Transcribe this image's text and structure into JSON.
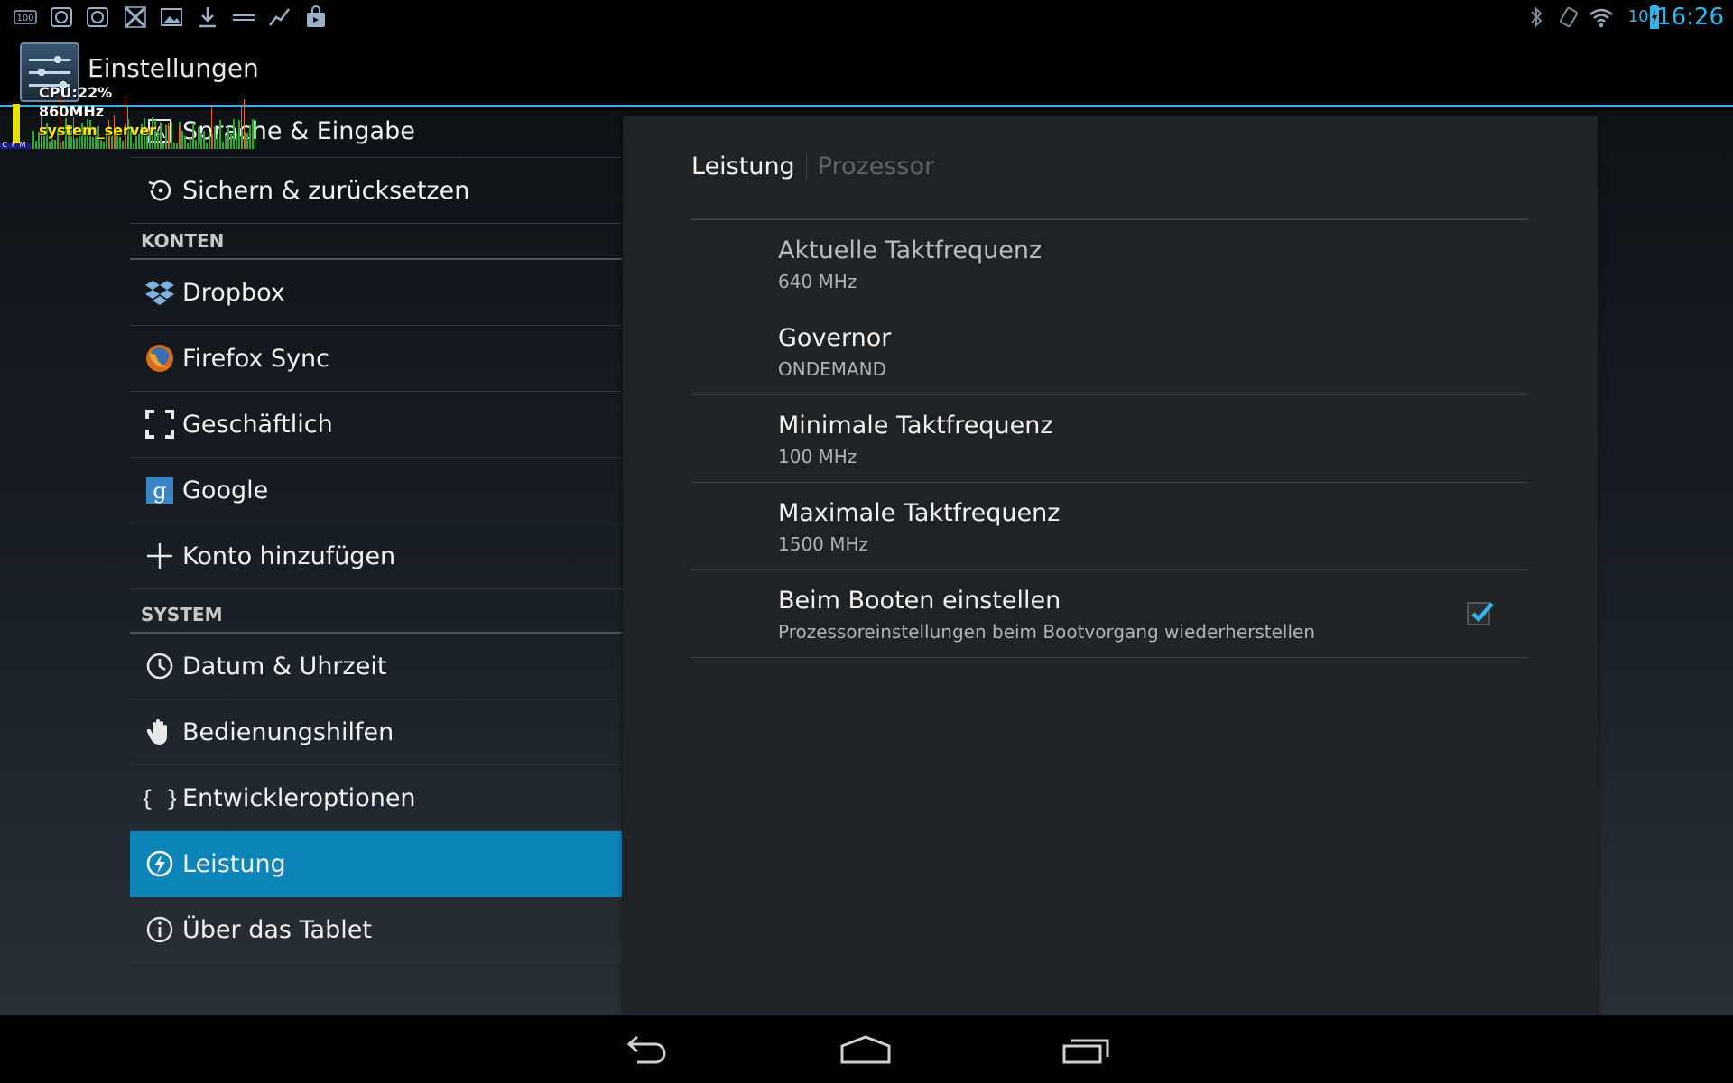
{
  "status_bar": {
    "notification_badge": "100",
    "battery_level": "100",
    "clock": "16:26",
    "left_icons": [
      "counter-badge-icon",
      "app-notification-icon",
      "app-notification-icon",
      "tools-icon",
      "image-icon",
      "download-icon",
      "keyboard-icon",
      "chart-icon",
      "shopping-bag-icon"
    ],
    "right_icons": [
      "bluetooth-icon",
      "screen-rotation-icon",
      "wifi-icon",
      "battery-charging-icon"
    ]
  },
  "action_bar": {
    "title": "Einstellungen",
    "app_icon": "settings-sliders-icon"
  },
  "cpu_overlay": {
    "cpu_label": "CPU:22%",
    "frequency_label": "860MHz",
    "process_label": "system_server",
    "legend_letters": [
      "C",
      "F",
      "M"
    ]
  },
  "settings_list": {
    "items": [
      {
        "label": "Sprache & Eingabe",
        "icon": "language-input-icon"
      },
      {
        "label": "Sichern & zurücksetzen",
        "icon": "backup-reset-icon"
      },
      {
        "label": "Dropbox",
        "icon": "dropbox-icon"
      },
      {
        "label": "Firefox Sync",
        "icon": "firefox-icon"
      },
      {
        "label": "Geschäftlich",
        "icon": "corporate-frame-icon"
      },
      {
        "label": "Google",
        "icon": "google-icon"
      },
      {
        "label": "Konto hinzufügen",
        "icon": "plus-icon"
      },
      {
        "label": "Datum & Uhrzeit",
        "icon": "clock-icon"
      },
      {
        "label": "Bedienungshilfen",
        "icon": "hand-icon"
      },
      {
        "label": "Entwickleroptionen",
        "icon": "braces-icon"
      },
      {
        "label": "Leistung",
        "icon": "performance-bolt-icon",
        "active": true
      },
      {
        "label": "Über das Tablet",
        "icon": "info-icon"
      }
    ],
    "sections": {
      "accounts": "KONTEN",
      "system": "SYSTEM"
    }
  },
  "detail": {
    "tabs": {
      "performance": "Leistung",
      "processor": "Prozessor"
    },
    "prefs": [
      {
        "title": "Aktuelle Taktfrequenz",
        "summary": "640 MHz"
      },
      {
        "title": "Governor",
        "summary": "ONDEMAND"
      },
      {
        "title": "Minimale Taktfrequenz",
        "summary": "100 MHz"
      },
      {
        "title": "Maximale Taktfrequenz",
        "summary": "1500 MHz"
      },
      {
        "title": "Beim Booten einstellen",
        "summary": "Prozessoreinstellungen beim Bootvorgang wiederherstellen",
        "checked": true
      }
    ]
  },
  "colors": {
    "accent": "#33b5e5",
    "selected_item": "#0e85b8",
    "panel_bg": "#202326"
  },
  "nav_bar": {
    "buttons": [
      "back-icon",
      "home-icon",
      "recent-apps-icon"
    ]
  }
}
